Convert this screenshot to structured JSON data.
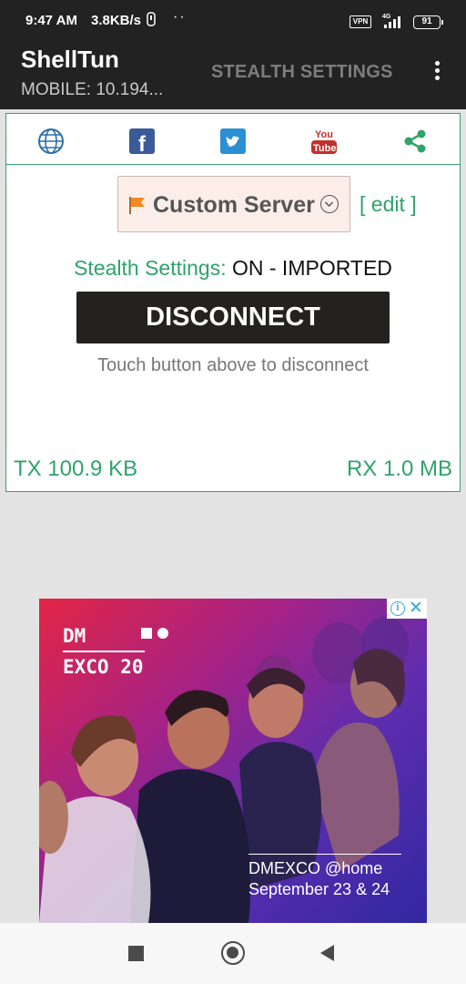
{
  "status_bar": {
    "time": "9:47 AM",
    "net_speed": "3.8KB/s",
    "vpn_badge": "VPN",
    "network_type": "4G",
    "battery": "91"
  },
  "app_bar": {
    "title": "ShellTun",
    "subtitle": "MOBILE: 10.194...",
    "action_label": "STEALTH SETTINGS"
  },
  "toolbar": {
    "icons": [
      "globe-icon",
      "facebook-icon",
      "twitter-icon",
      "youtube-icon",
      "share-icon"
    ],
    "youtube_top": "You",
    "youtube_bottom": "Tube",
    "facebook_letter": "f"
  },
  "server": {
    "selected": "Custom Server",
    "edit_label": "[ edit ]"
  },
  "stealth": {
    "label": "Stealth Settings:",
    "value": "ON - IMPORTED"
  },
  "connection": {
    "button_label": "DISCONNECT",
    "hint": "Touch button above to disconnect",
    "tx": "TX 100.9 KB",
    "rx": "RX 1.0 MB"
  },
  "ad": {
    "brand_line1": "DM",
    "brand_line2": "EXCO 20",
    "tagline1": "DMEXCO @home",
    "tagline2": "September 23 & 24",
    "choices_i": "i",
    "close": "✕"
  },
  "colors": {
    "accent_green": "#2fa36a",
    "app_bar": "#222222",
    "button_dark": "#242121"
  }
}
